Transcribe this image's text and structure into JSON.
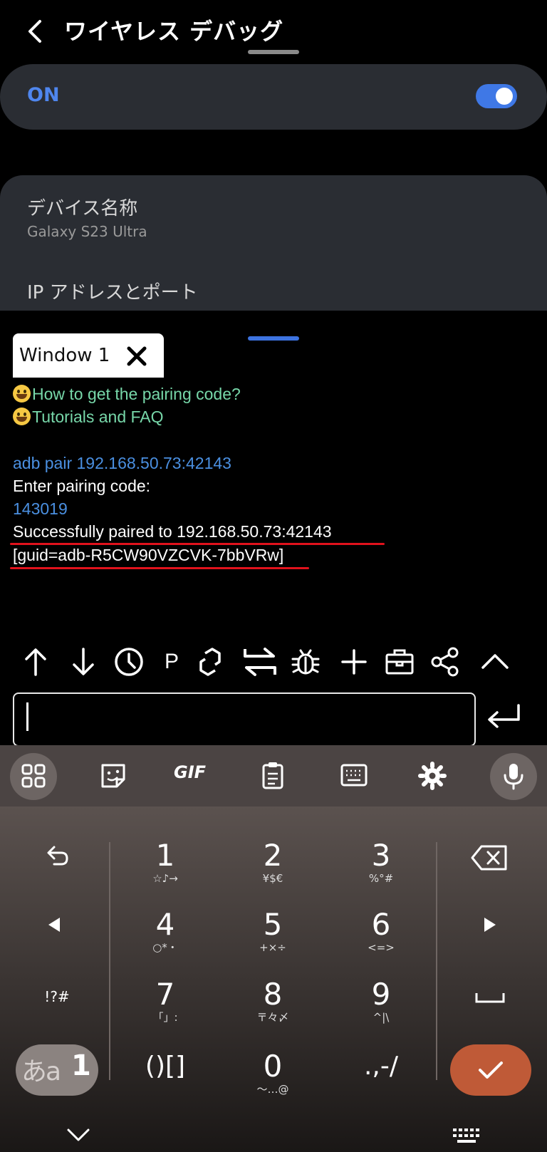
{
  "header": {
    "title": "ワイヤレス デバッグ",
    "back_icon": "back-arrow-icon"
  },
  "toggle_card": {
    "label": "ON",
    "state": "on",
    "accent": "#3f78e6"
  },
  "device_info": {
    "name_label": "デバイス名称",
    "name_value": "Galaxy S23 Ultra",
    "ip_label": "IP アドレスとポート"
  },
  "window": {
    "tab_label": "Window 1",
    "close_icon": "close-icon"
  },
  "terminal": {
    "link_howto": "How to get the pairing code?",
    "link_tutorial": "Tutorials and FAQ",
    "command": "adb  pair 192.168.50.73:42143",
    "prompt": "Enter pairing code:",
    "code": "143019",
    "success": "Successfully paired to 192.168.50.73:42143",
    "guid": "[guid=adb-R5CW90VZCVK-7bbVRw]",
    "link_color": "#77d7a9",
    "input_color": "#4a8fe0",
    "highlight_color": "#e0121c"
  },
  "toolbar": {
    "icons": [
      "arrow-up-icon",
      "arrow-down-icon",
      "history-clock-icon",
      "p-icon",
      "link-icon",
      "swap-icon",
      "bug-icon",
      "plus-icon",
      "toolbox-icon",
      "share-icon",
      "chevron-up-icon"
    ],
    "p_label": "P"
  },
  "input": {
    "value": ""
  },
  "keyboard": {
    "toolbar_icons": [
      "apps-grid-icon",
      "sticker-icon",
      "gif-icon",
      "clipboard-icon",
      "keyboard-icon",
      "settings-gear-icon",
      "mic-icon"
    ],
    "gif_label": "GIF",
    "keys": [
      {
        "main": "1",
        "sub": "☆♪→"
      },
      {
        "main": "2",
        "sub": "¥$€"
      },
      {
        "main": "3",
        "sub": "%°#"
      },
      {
        "main": "4",
        "sub": "○*・"
      },
      {
        "main": "5",
        "sub": "+×÷"
      },
      {
        "main": "6",
        "sub": "<=>"
      },
      {
        "main": "7",
        "sub": "「」:"
      },
      {
        "main": "8",
        "sub": "〒々〆"
      },
      {
        "main": "9",
        "sub": "^|\\"
      },
      {
        "main": "()[]",
        "sub": ""
      },
      {
        "main": "0",
        "sub": "〜…@"
      },
      {
        "main": ".,-/",
        "sub": ""
      }
    ],
    "symbols_key": "!?#",
    "mode_key": "あa",
    "mode_key_num": "1",
    "confirm_color": "#bf5a37"
  }
}
